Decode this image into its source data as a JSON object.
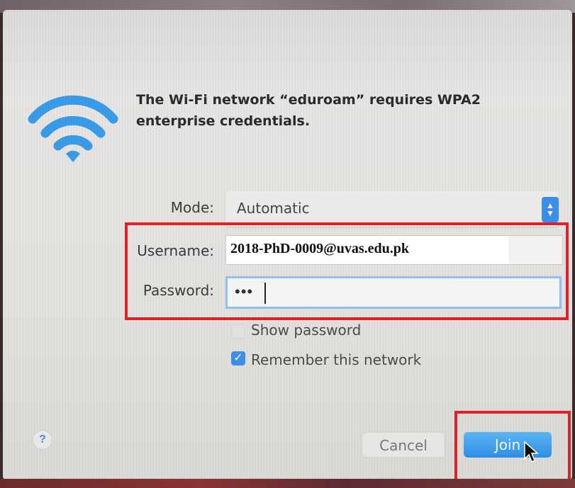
{
  "dialog": {
    "title": "The Wi-Fi network “eduroam” requires WPA2 enterprise credentials.",
    "icon": "wifi-icon"
  },
  "form": {
    "mode_label": "Mode:",
    "mode_value": "Automatic",
    "username_label": "Username:",
    "username_value": "2018-PhD-0009@uvas.edu.pk",
    "password_label": "Password:",
    "password_value": "•••",
    "show_password_label": "Show password",
    "show_password_checked": false,
    "remember_label": "Remember this network",
    "remember_checked": true
  },
  "buttons": {
    "help": "?",
    "cancel": "Cancel",
    "join": "Join"
  },
  "colors": {
    "accent": "#3d8ee6",
    "highlight": "#e0202a",
    "wifi": "#3a9be8"
  }
}
